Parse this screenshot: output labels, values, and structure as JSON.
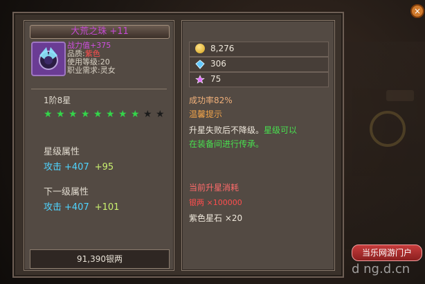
{
  "item": {
    "name": "大荒之珠",
    "enhance": "+11",
    "power": "战力值+375",
    "quality_label": "品质:",
    "quality_value": "紫色",
    "required_level": "使用等级:20",
    "required_job": "职业需求:灵女",
    "stars_level": "1阶8星",
    "stars_total": 10,
    "stars_filled": 8
  },
  "left": {
    "current_attr_title": "星级属性",
    "current_attr": {
      "label": "攻击",
      "base": "+407",
      "bonus": "+95"
    },
    "next_attr_title": "下一级属性",
    "next_attr": {
      "label": "攻击",
      "base": "+407",
      "bonus": "+101"
    },
    "cost": "91,390银两"
  },
  "right": {
    "currency": [
      {
        "icon": "gold-coin-icon",
        "value": "8,276"
      },
      {
        "icon": "diamond-icon",
        "value": "306"
      },
      {
        "icon": "purple-star-icon",
        "value": "75"
      }
    ],
    "success_rate": "成功率82%",
    "tip_title": "温馨提示",
    "tip_line1": "升星失败后不降级。",
    "tip_line1_highlight": "星级可以",
    "tip_line2": "在装备间进行传承。",
    "consume_title": "当前升星消耗",
    "consume_silver": "银两 ×100000",
    "consume_stone": "紫色星石 ×20"
  },
  "ui": {
    "portal": "当乐网游门户",
    "watermark": "d ng.d.cn",
    "close": "×"
  }
}
